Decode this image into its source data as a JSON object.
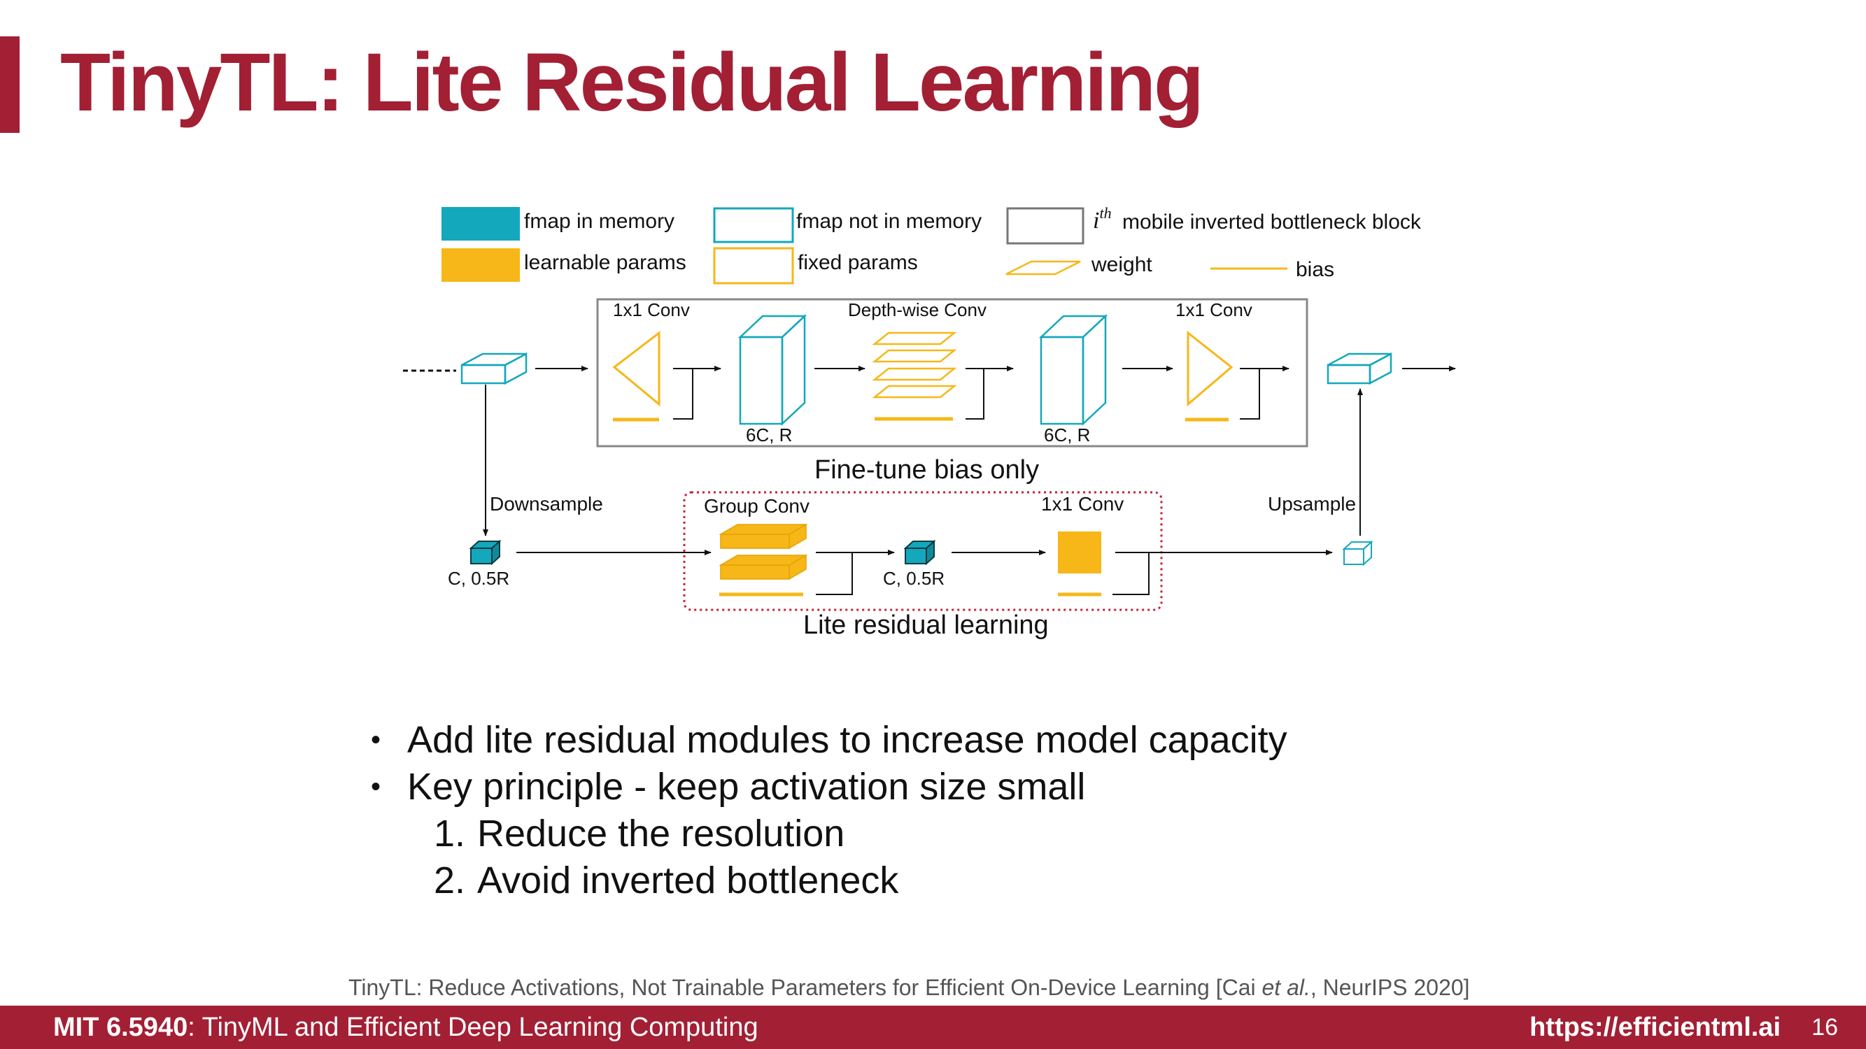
{
  "slide": {
    "title": "TinyTL: Lite Residual Learning",
    "bullets": [
      "Add lite residual modules to increase model capacity",
      "Key principle - keep activation size small"
    ],
    "numbered": [
      {
        "num": "1.",
        "text": "Reduce the resolution"
      },
      {
        "num": "2.",
        "text": "Avoid inverted bottleneck"
      }
    ],
    "citation": {
      "before": "TinyTL: Reduce Activations, Not Trainable Parameters for Efficient On-Device Learning [Cai ",
      "etal": "et al.",
      "after": ", NeurIPS 2020]"
    }
  },
  "legend": {
    "fmap_in_memory": "fmap in memory",
    "fmap_not_in_memory": "fmap not in memory",
    "block_label": "mobile inverted bottleneck block",
    "block_symbol": "i",
    "block_sup": "th",
    "learnable_params": "learnable params",
    "fixed_params": "fixed params",
    "weight": "weight",
    "bias": "bias"
  },
  "diagram": {
    "conv1": "1x1 Conv",
    "dwconv": "Depth-wise Conv",
    "conv2": "1x1 Conv",
    "dim1": "6C, R",
    "dim2": "6C, R",
    "finetune_caption": "Fine-tune bias only",
    "downsample": "Downsample",
    "upsample": "Upsample",
    "group_conv": "Group Conv",
    "conv_lite": "1x1 Conv",
    "dim_small1": "C, 0.5R",
    "dim_small2": "C, 0.5R",
    "lite_caption": "Lite residual learning"
  },
  "footer": {
    "course_code": "MIT 6.5940",
    "course_name": ": TinyML and Efficient Deep Learning Computing",
    "url": "https://efficientml.ai",
    "page": "16"
  },
  "colors": {
    "accent": "#a31f34",
    "teal": "#13a8bb",
    "yellow": "#f7b718",
    "dotted_red": "#c2233f"
  }
}
